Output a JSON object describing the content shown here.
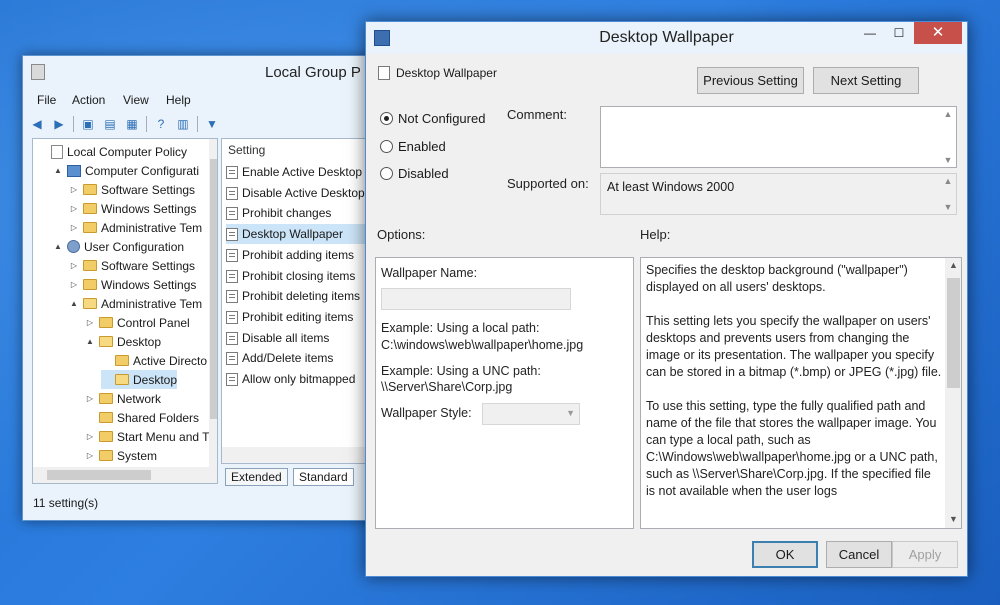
{
  "gpe": {
    "title": "Local Group P",
    "menu": [
      "File",
      "Action",
      "View",
      "Help"
    ],
    "tree": [
      {
        "label": "Local Computer Policy",
        "depth": 0,
        "arrow": "",
        "icon": "policy"
      },
      {
        "label": "Computer Configurati",
        "depth": 1,
        "arrow": "▲",
        "icon": "pc"
      },
      {
        "label": "Software Settings",
        "depth": 2,
        "arrow": "▷",
        "icon": "folder"
      },
      {
        "label": "Windows Settings",
        "depth": 2,
        "arrow": "▷",
        "icon": "folder"
      },
      {
        "label": "Administrative Tem",
        "depth": 2,
        "arrow": "▷",
        "icon": "folder"
      },
      {
        "label": "User Configuration",
        "depth": 1,
        "arrow": "▲",
        "icon": "user"
      },
      {
        "label": "Software Settings",
        "depth": 2,
        "arrow": "▷",
        "icon": "folder"
      },
      {
        "label": "Windows Settings",
        "depth": 2,
        "arrow": "▷",
        "icon": "folder"
      },
      {
        "label": "Administrative Tem",
        "depth": 2,
        "arrow": "▲",
        "icon": "folder-open"
      },
      {
        "label": "Control Panel",
        "depth": 3,
        "arrow": "▷",
        "icon": "folder"
      },
      {
        "label": "Desktop",
        "depth": 3,
        "arrow": "▲",
        "icon": "folder-open"
      },
      {
        "label": "Active Directo",
        "depth": 4,
        "arrow": "",
        "icon": "folder"
      },
      {
        "label": "Desktop",
        "depth": 4,
        "arrow": "",
        "icon": "folder-open"
      },
      {
        "label": "Network",
        "depth": 3,
        "arrow": "▷",
        "icon": "folder"
      },
      {
        "label": "Shared Folders",
        "depth": 3,
        "arrow": "",
        "icon": "folder"
      },
      {
        "label": "Start Menu and T",
        "depth": 3,
        "arrow": "▷",
        "icon": "folder"
      },
      {
        "label": "System",
        "depth": 3,
        "arrow": "▷",
        "icon": "folder"
      }
    ],
    "list_header": "Setting",
    "settings": [
      "Enable Active Desktop",
      "Disable Active Desktop",
      "Prohibit changes",
      "Desktop Wallpaper",
      "Prohibit adding items",
      "Prohibit closing items",
      "Prohibit deleting items",
      "Prohibit editing items",
      "Disable all items",
      "Add/Delete items",
      "Allow only bitmapped"
    ],
    "tabs": [
      "Extended",
      "Standard"
    ],
    "status": "11 setting(s)"
  },
  "dialog": {
    "title": "Desktop Wallpaper",
    "heading": "Desktop Wallpaper",
    "previous_button": "Previous Setting",
    "next_button": "Next Setting",
    "radio_not_configured": "Not Configured",
    "radio_enabled": "Enabled",
    "radio_disabled": "Disabled",
    "comment_label": "Comment:",
    "supported_label": "Supported on:",
    "supported_value": "At least Windows 2000",
    "options_label": "Options:",
    "help_label": "Help:",
    "options": {
      "wallpaper_name": "Wallpaper Name:",
      "example_local": "Example: Using a local path:",
      "local_path": "C:\\windows\\web\\wallpaper\\home.jpg",
      "example_unc": "Example: Using a UNC path:",
      "unc_path": "\\\\Server\\Share\\Corp.jpg",
      "wallpaper_style": "Wallpaper Style:"
    },
    "help_text": "Specifies the desktop background (\"wallpaper\") displayed on all users' desktops.\n\nThis setting lets you specify the wallpaper on users' desktops and prevents users from changing the image or its presentation. The wallpaper you specify can be stored in a bitmap (*.bmp) or JPEG (*.jpg) file.\n\nTo use this setting, type the fully qualified path and name of the file that stores the wallpaper image. You can type a local path, such as C:\\Windows\\web\\wallpaper\\home.jpg or a UNC path, such as \\\\Server\\Share\\Corp.jpg. If the specified file is not available when the user logs",
    "ok_button": "OK",
    "cancel_button": "Cancel",
    "apply_button": "Apply",
    "close_glyph": "✕",
    "minimize_glyph": "—",
    "maximize_glyph": "☐"
  }
}
